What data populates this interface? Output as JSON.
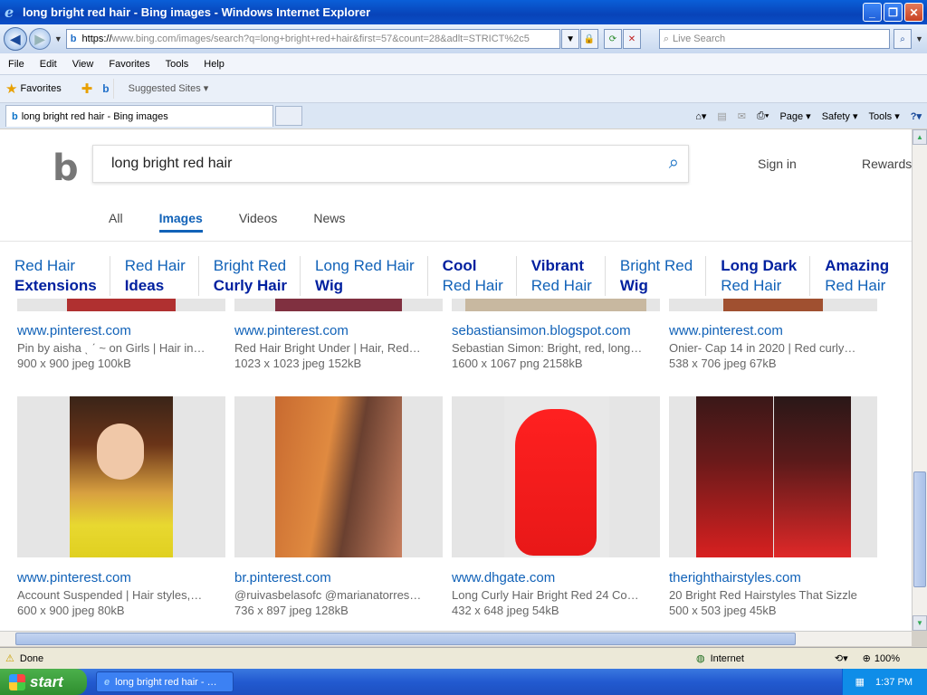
{
  "window": {
    "title": "long bright red hair - Bing images - Windows Internet Explorer"
  },
  "address": {
    "url_prefix": "https://",
    "url_domain": "www.bing.com",
    "url_rest": "/images/search?q=long+bright+red+hair&first=57&count=28&adlt=STRICT%2c5",
    "search_placeholder": "Live Search"
  },
  "menu": [
    "File",
    "Edit",
    "View",
    "Favorites",
    "Tools",
    "Help"
  ],
  "favorites": {
    "label": "Favorites",
    "suggested": "Suggested Sites ▾"
  },
  "tab": {
    "label": "long bright red hair - Bing images"
  },
  "toolbar": {
    "page": "Page ▾",
    "safety": "Safety ▾",
    "tools": "Tools ▾"
  },
  "bing": {
    "query": "long bright red hair",
    "sign_in": "Sign in",
    "rewards": "Rewards",
    "nav": [
      "All",
      "Images",
      "Videos",
      "News"
    ],
    "suggestions": [
      {
        "a": "Red Hair",
        "b": "Extensions"
      },
      {
        "a": "Red Hair",
        "b": "Ideas"
      },
      {
        "a": "Bright Red",
        "b": "Curly Hair"
      },
      {
        "a": "Long Red Hair",
        "b": "Wig"
      },
      {
        "a": "Cool",
        "b": "Red Hair"
      },
      {
        "a": "Vibrant",
        "b": "Red Hair"
      },
      {
        "a": "Bright Red",
        "b": "Wig"
      },
      {
        "a": "Long Dark",
        "b": "Red Hair"
      },
      {
        "a": "Amazing",
        "b": "Red Hair"
      }
    ],
    "row1": [
      {
        "host": "www.pinterest.com",
        "desc": "Pin by aisha ˎ ˊ ~ on Girls | Hair in…",
        "meta": "900 x 900 jpeg 100kB"
      },
      {
        "host": "www.pinterest.com",
        "desc": "Red Hair Bright Under | Hair, Red…",
        "meta": "1023 x 1023 jpeg 152kB"
      },
      {
        "host": "sebastiansimon.blogspot.com",
        "desc": "Sebastian Simon: Bright, red, long…",
        "meta": "1600 x 1067 png 2158kB"
      },
      {
        "host": "www.pinterest.com",
        "desc": "Onier- Cap 14 in 2020 | Red curly…",
        "meta": "538 x 706 jpeg 67kB"
      }
    ],
    "row2": [
      {
        "host": "www.pinterest.com",
        "desc": "Account Suspended | Hair styles,…",
        "meta": "600 x 900 jpeg 80kB"
      },
      {
        "host": "br.pinterest.com",
        "desc": "@ruivasbelasofc @marianatorres…",
        "meta": "736 x 897 jpeg 128kB"
      },
      {
        "host": "www.dhgate.com",
        "desc": "Long Curly Hair Bright Red 24 Co…",
        "meta": "432 x 648 jpeg 54kB"
      },
      {
        "host": "therighthairstyles.com",
        "desc": "20 Bright Red Hairstyles That Sizzle",
        "meta": "500 x 503 jpeg 45kB"
      }
    ]
  },
  "status": {
    "text": "Done",
    "zone": "Internet",
    "zoom": "100%"
  },
  "taskbar": {
    "start": "start",
    "task": "long bright red hair - …",
    "clock": "1:37 PM"
  }
}
